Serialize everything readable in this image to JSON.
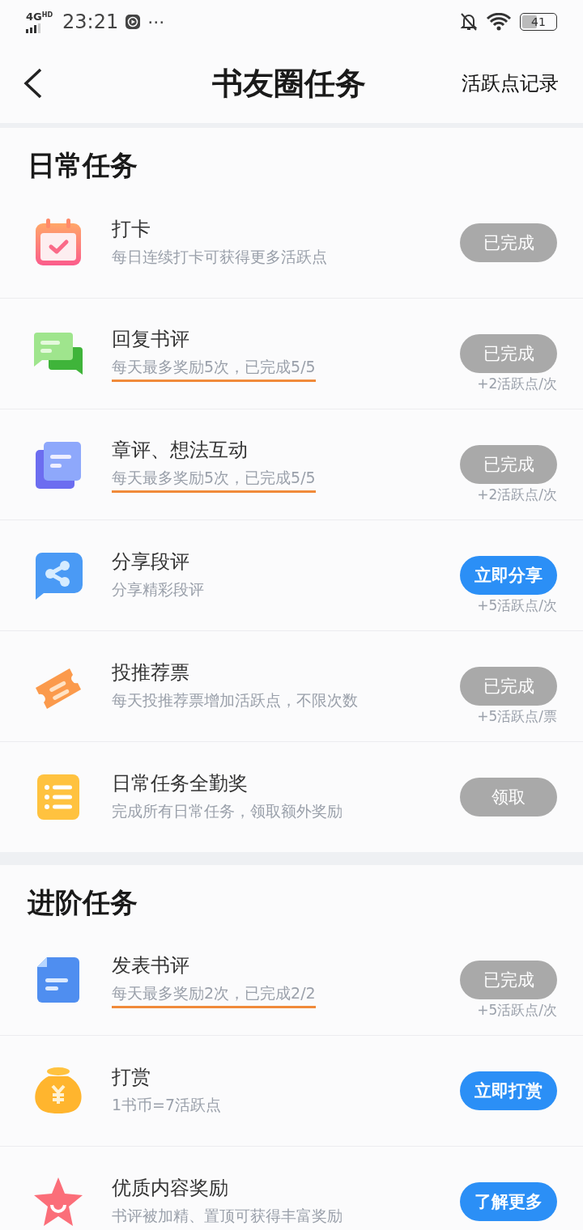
{
  "status_bar": {
    "network": "4G",
    "network_badge": "HD",
    "time": "23:21",
    "more": "···",
    "battery": "41"
  },
  "header": {
    "title": "书友圈任务",
    "action": "活跃点记录"
  },
  "sections": [
    {
      "title": "日常任务",
      "tasks": [
        {
          "kind": "calendar",
          "title": "打卡",
          "subtitle": "每日连续打卡可获得更多活跃点",
          "underlined": false,
          "button": "已完成",
          "disabled": true
        },
        {
          "kind": "chat",
          "title": "回复书评",
          "subtitle": "每天最多奖励5次，已完成5/5",
          "underlined": true,
          "button": "已完成",
          "disabled": true,
          "reward": "+2活跃点/次"
        },
        {
          "kind": "pages",
          "title": "章评、想法互动",
          "subtitle": "每天最多奖励5次，已完成5/5",
          "underlined": true,
          "button": "已完成",
          "disabled": true,
          "reward": "+2活跃点/次"
        },
        {
          "kind": "share",
          "title": "分享段评",
          "subtitle": "分享精彩段评",
          "underlined": false,
          "button": "立即分享",
          "disabled": false,
          "reward": "+5活跃点/次"
        },
        {
          "kind": "ticket",
          "title": "投推荐票",
          "subtitle": "每天投推荐票增加活跃点，不限次数",
          "underlined": false,
          "button": "已完成",
          "disabled": true,
          "reward": "+5活跃点/票"
        },
        {
          "kind": "list",
          "title": "日常任务全勤奖",
          "subtitle": "完成所有日常任务，领取额外奖励",
          "underlined": false,
          "button": "领取",
          "disabled": true
        }
      ]
    },
    {
      "title": "进阶任务",
      "tasks": [
        {
          "kind": "document",
          "title": "发表书评",
          "subtitle": "每天最多奖励2次，已完成2/2",
          "underlined": true,
          "button": "已完成",
          "disabled": true,
          "reward": "+5活跃点/次"
        },
        {
          "kind": "moneybag",
          "title": "打赏",
          "subtitle": "1书币=7活跃点",
          "underlined": false,
          "button": "立即打赏",
          "disabled": false
        },
        {
          "kind": "star",
          "title": "优质内容奖励",
          "subtitle": "书评被加精、置顶可获得丰富奖励",
          "underlined": false,
          "button": "了解更多",
          "disabled": false
        }
      ]
    }
  ]
}
